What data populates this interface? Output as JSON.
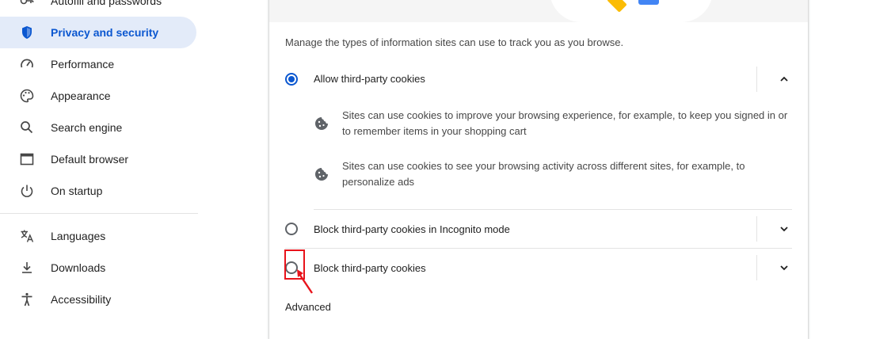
{
  "sidebar": {
    "items": [
      {
        "label": "Autofill and passwords",
        "icon": "key-icon"
      },
      {
        "label": "Privacy and security",
        "icon": "shield-icon",
        "active": true
      },
      {
        "label": "Performance",
        "icon": "speedometer-icon"
      },
      {
        "label": "Appearance",
        "icon": "palette-icon"
      },
      {
        "label": "Search engine",
        "icon": "search-icon"
      },
      {
        "label": "Default browser",
        "icon": "browser-window-icon"
      },
      {
        "label": "On startup",
        "icon": "power-icon"
      },
      {
        "label": "Languages",
        "icon": "translate-icon"
      },
      {
        "label": "Downloads",
        "icon": "download-icon"
      },
      {
        "label": "Accessibility",
        "icon": "accessibility-icon"
      }
    ]
  },
  "main": {
    "description": "Manage the types of information sites can use to track you as you browse.",
    "options": [
      {
        "label": "Allow third-party cookies",
        "selected": true,
        "expanded": true,
        "details": [
          "Sites can use cookies to improve your browsing experience, for example, to keep you signed in or to remember items in your shopping cart",
          "Sites can use cookies to see your browsing activity across different sites, for example, to personalize ads"
        ]
      },
      {
        "label": "Block third-party cookies in Incognito mode",
        "selected": false,
        "expanded": false
      },
      {
        "label": "Block third-party cookies",
        "selected": false,
        "expanded": false
      }
    ],
    "advanced_heading": "Advanced"
  },
  "colors": {
    "accent": "#0b57d0",
    "active_bg": "#e3ebf9",
    "annotation": "#e8131b"
  }
}
